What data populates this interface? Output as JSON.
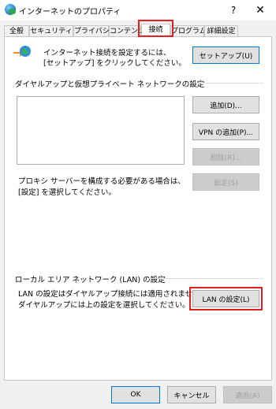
{
  "window": {
    "title": "インターネットのプロパティ",
    "help": "?",
    "close": "✕"
  },
  "tabs": [
    {
      "label": "全般"
    },
    {
      "label": "セキュリティ"
    },
    {
      "label": "プライバシー"
    },
    {
      "label": "コンテンツ"
    },
    {
      "label": "接続"
    },
    {
      "label": "プログラム"
    },
    {
      "label": "詳細設定"
    }
  ],
  "active_tab": "接続",
  "setup": {
    "text": "インターネット接続を設定するには、\n[セットアップ] をクリックしてください。",
    "button": "セットアップ(U)"
  },
  "dialup": {
    "heading": "ダイヤルアップと仮想プライベート ネットワークの設定",
    "buttons": {
      "add": "追加(D)...",
      "add_vpn": "VPN の追加(P)...",
      "remove": "削除(R)...",
      "settings": "設定(S)"
    },
    "proxy_text": "プロキシ サーバーを構成する必要がある場合は、\n[設定] を選択してください。"
  },
  "lan": {
    "heading": "ローカル エリア ネットワーク (LAN) の設定",
    "text": "LAN の設定はダイヤルアップ接続には適用されません。\nダイヤルアップには上の設定を選択してください。",
    "button": "LAN の設定(L)"
  },
  "footer": {
    "ok": "OK",
    "cancel": "キャンセル",
    "apply": "適用(A)"
  },
  "colors": {
    "highlight": "#e12020",
    "focus_border": "#0078d7",
    "disabled_text": "#a0a0a0"
  }
}
